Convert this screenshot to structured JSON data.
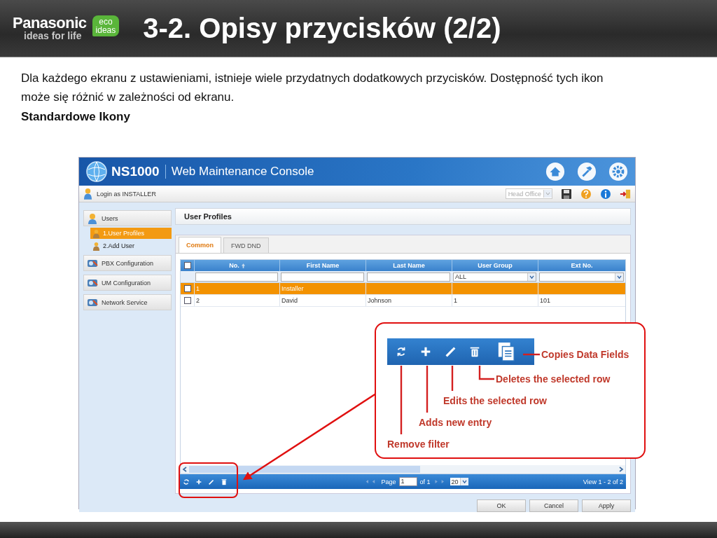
{
  "header": {
    "brand": "Panasonic",
    "tagline": "ideas for life",
    "eco_badge": [
      "eco",
      "ideas"
    ],
    "title": "3-2. Opisy przycisków (2/2)"
  },
  "intro": {
    "paragraph": "Dla każdego ekranu z ustawieniami, istnieje wiele przydatnych dodatkowych przycisków. Dostępność tych ikon może się różnić w zależności od ekranu.",
    "subheading": "Standardowe Ikony"
  },
  "console": {
    "product": "NS1000",
    "title": "Web Maintenance Console",
    "login": "Login as INSTALLER",
    "site_select": "Head Office",
    "sidebar": [
      {
        "label": "Users",
        "children": [
          {
            "label": "1.User Profiles",
            "selected": true
          },
          {
            "label": "2.Add User",
            "selected": false
          }
        ]
      },
      {
        "label": "PBX Configuration"
      },
      {
        "label": "UM Configuration"
      },
      {
        "label": "Network Service"
      }
    ],
    "panel_title": "User Profiles",
    "tabs": [
      {
        "label": "Common",
        "selected": true
      },
      {
        "label": "FWD DND",
        "selected": false
      }
    ],
    "table": {
      "header_checked": false,
      "columns": [
        "No.",
        "First Name",
        "Last Name",
        "User Group",
        "Ext No."
      ],
      "filters": [
        {
          "kind": "text"
        },
        {
          "kind": "text"
        },
        {
          "kind": "text"
        },
        {
          "kind": "select",
          "value": "ALL"
        },
        {
          "kind": "select"
        }
      ],
      "rows": [
        {
          "selected": true,
          "checked": false,
          "cells": [
            "1",
            "Installer",
            null,
            null,
            null
          ]
        },
        {
          "selected": false,
          "checked": false,
          "cells": [
            "2",
            "David",
            "Johnson",
            "1",
            "101"
          ]
        }
      ]
    },
    "pager": {
      "page_label": "Page",
      "page": "1",
      "of": "of 1",
      "page_size": "20",
      "view": "View 1 - 2 of 2"
    },
    "buttons": [
      "OK",
      "Cancel",
      "Apply"
    ]
  },
  "callout": {
    "labels": [
      "Copies Data Fields",
      "Deletes the selected row",
      "Edits the selected row",
      "Adds new entry",
      "Remove filter"
    ]
  }
}
